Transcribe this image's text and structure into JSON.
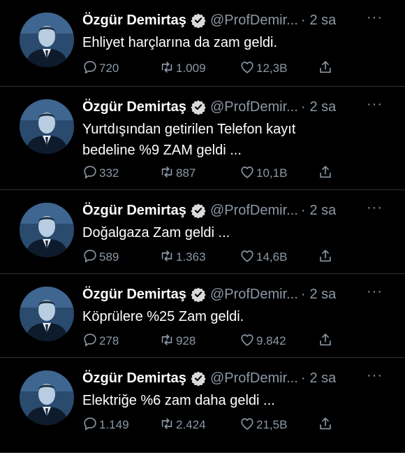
{
  "colors": {
    "background": "#000000",
    "text": "#ffffff",
    "muted": "#8b98a5",
    "divider": "#2f3336",
    "verified": "#d9d9d9"
  },
  "tweets": [
    {
      "name": "Özgür Demirtaş",
      "handle": "@ProfDemir...",
      "separator": "·",
      "time": "2 sa",
      "more": "···",
      "lines": [
        "Ehliyet harçlarına da zam geldi."
      ],
      "replies": "720",
      "retweets": "1.009",
      "likes": "12,3B"
    },
    {
      "name": "Özgür Demirtaş",
      "handle": "@ProfDemir...",
      "separator": "·",
      "time": "2 sa",
      "more": "···",
      "lines": [
        "Yurtdışından getirilen Telefon kayıt",
        "bedeline %9 ZAM geldi ..."
      ],
      "replies": "332",
      "retweets": "887",
      "likes": "10,1B"
    },
    {
      "name": "Özgür Demirtaş",
      "handle": "@ProfDemir...",
      "separator": "·",
      "time": "2 sa",
      "more": "···",
      "lines": [
        "Doğalgaza Zam geldi ..."
      ],
      "replies": "589",
      "retweets": "1.363",
      "likes": "14,6B"
    },
    {
      "name": "Özgür Demirtaş",
      "handle": "@ProfDemir...",
      "separator": "·",
      "time": "2 sa",
      "more": "···",
      "lines": [
        "Köprülere %25 Zam geldi."
      ],
      "replies": "278",
      "retweets": "928",
      "likes": "9.842"
    },
    {
      "name": "Özgür Demirtaş",
      "handle": "@ProfDemir...",
      "separator": "·",
      "time": "2 sa",
      "more": "···",
      "lines": [
        "Elektriğe %6 zam daha geldi ..."
      ],
      "replies": "1.149",
      "retweets": "2.424",
      "likes": "21,5B"
    }
  ]
}
